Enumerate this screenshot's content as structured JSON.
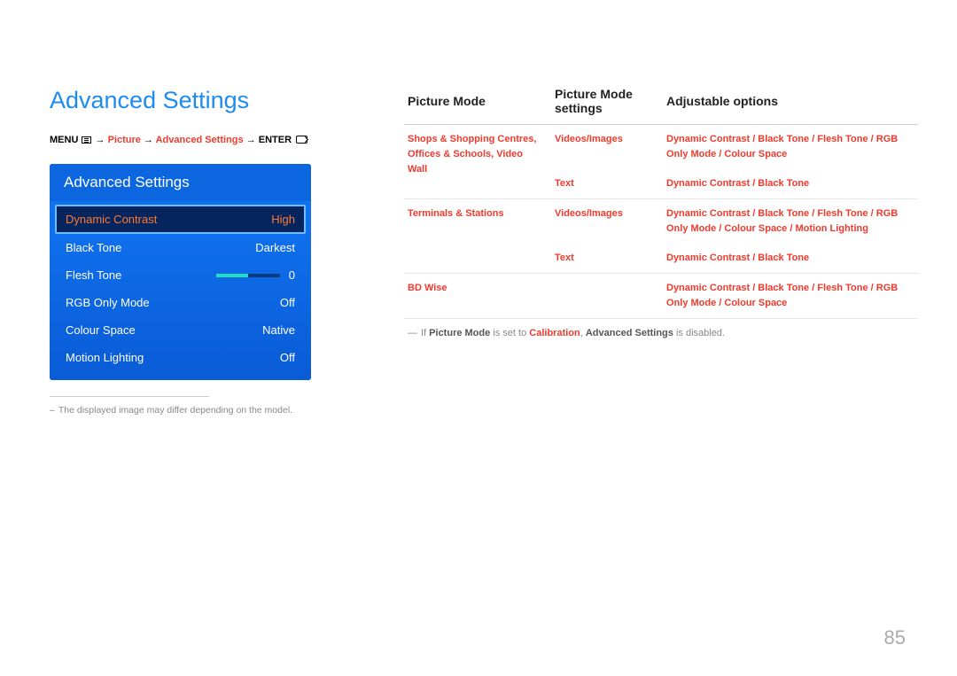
{
  "page_number": "85",
  "left": {
    "title": "Advanced Settings",
    "breadcrumb": {
      "menu_label": "MENU",
      "arrow": "→",
      "path1": "Picture",
      "path2": "Advanced Settings",
      "enter_label": "ENTER"
    },
    "osd": {
      "header": "Advanced Settings",
      "rows": [
        {
          "label": "Dynamic Contrast",
          "value": "High",
          "highlight": true
        },
        {
          "label": "Black Tone",
          "value": "Darkest"
        },
        {
          "label": "Flesh Tone",
          "value": "0",
          "slider": true
        },
        {
          "label": "RGB Only Mode",
          "value": "Off"
        },
        {
          "label": "Colour Space",
          "value": "Native"
        },
        {
          "label": "Motion Lighting",
          "value": "Off"
        }
      ]
    },
    "footnote": "The displayed image may differ depending on the model."
  },
  "right": {
    "headers": {
      "c1": "Picture Mode",
      "c2": "Picture Mode settings",
      "c3": "Adjustable options"
    },
    "rows": [
      {
        "c1": "Shops & Shopping Centres, Offices & Schools, Video Wall",
        "c2": "Videos/Images",
        "c3": "Dynamic Contrast / Black Tone / Flesh Tone / RGB Only Mode / Colour Space"
      },
      {
        "c1": "",
        "c2": "Text",
        "c3": "Dynamic Contrast / Black Tone"
      },
      {
        "c1": "Terminals & Stations",
        "c2": "Videos/Images",
        "c3": "Dynamic Contrast / Black Tone / Flesh Tone / RGB Only Mode / Colour Space / Motion Lighting"
      },
      {
        "c1": "",
        "c2": "Text",
        "c3": "Dynamic Contrast / Black Tone"
      },
      {
        "c1": "BD Wise",
        "c2": "",
        "c3": "Dynamic Contrast / Black Tone / Flesh Tone / RGB Only Mode / Colour Space"
      }
    ],
    "note": {
      "prefix": "If ",
      "pm": "Picture Mode",
      "mid": " is set to ",
      "cal": "Calibration",
      "comma": ", ",
      "as": "Advanced Settings",
      "suffix": " is disabled."
    }
  }
}
